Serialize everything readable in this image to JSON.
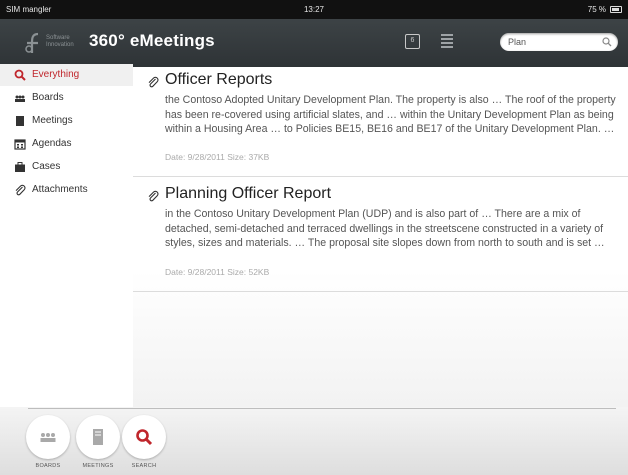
{
  "status_bar": {
    "carrier": "SIM mangler",
    "time": "13:27",
    "battery": "75 %"
  },
  "header": {
    "logo_text": "Software\nInnovation",
    "title": "360° eMeetings",
    "calendar_day": "6",
    "search_value": "Plan"
  },
  "sidebar": {
    "items": [
      {
        "label": "Everything",
        "icon": "search-icon",
        "active": true
      },
      {
        "label": "Boards",
        "icon": "people-icon",
        "active": false
      },
      {
        "label": "Meetings",
        "icon": "book-icon",
        "active": false
      },
      {
        "label": "Agendas",
        "icon": "calendar-icon",
        "active": false
      },
      {
        "label": "Cases",
        "icon": "briefcase-icon",
        "active": false
      },
      {
        "label": "Attachments",
        "icon": "paperclip-icon",
        "active": false
      }
    ]
  },
  "results": [
    {
      "title": "Officer Reports",
      "snippet": "the Contoso Adopted Unitary Development Plan. The property is also … The roof of the property has been re-covered using artificial slates, and … within the Unitary Development Plan as being within a Housing Area … to Policies BE15, BE16 and BE17 of the Unitary Development Plan. …",
      "meta": "Date: 9/28/2011   Size: 37KB"
    },
    {
      "title": "Planning Officer Report",
      "snippet": "in the Contoso Unitary Development Plan (UDP) and is also part of … There are a mix of detached, semi-detached and terraced dwellings in the streetscene constructed in a variety of styles, sizes and materials. … The proposal site slopes down from north to south and is set …",
      "meta": "Date: 9/28/2011   Size: 52KB"
    }
  ],
  "dock": {
    "boards_label": "BOARDS",
    "meetings_label": "MEETINGS",
    "search_label": "SEARCH"
  },
  "colors": {
    "accent": "#c0262c",
    "header_bg": "#353a3d"
  }
}
